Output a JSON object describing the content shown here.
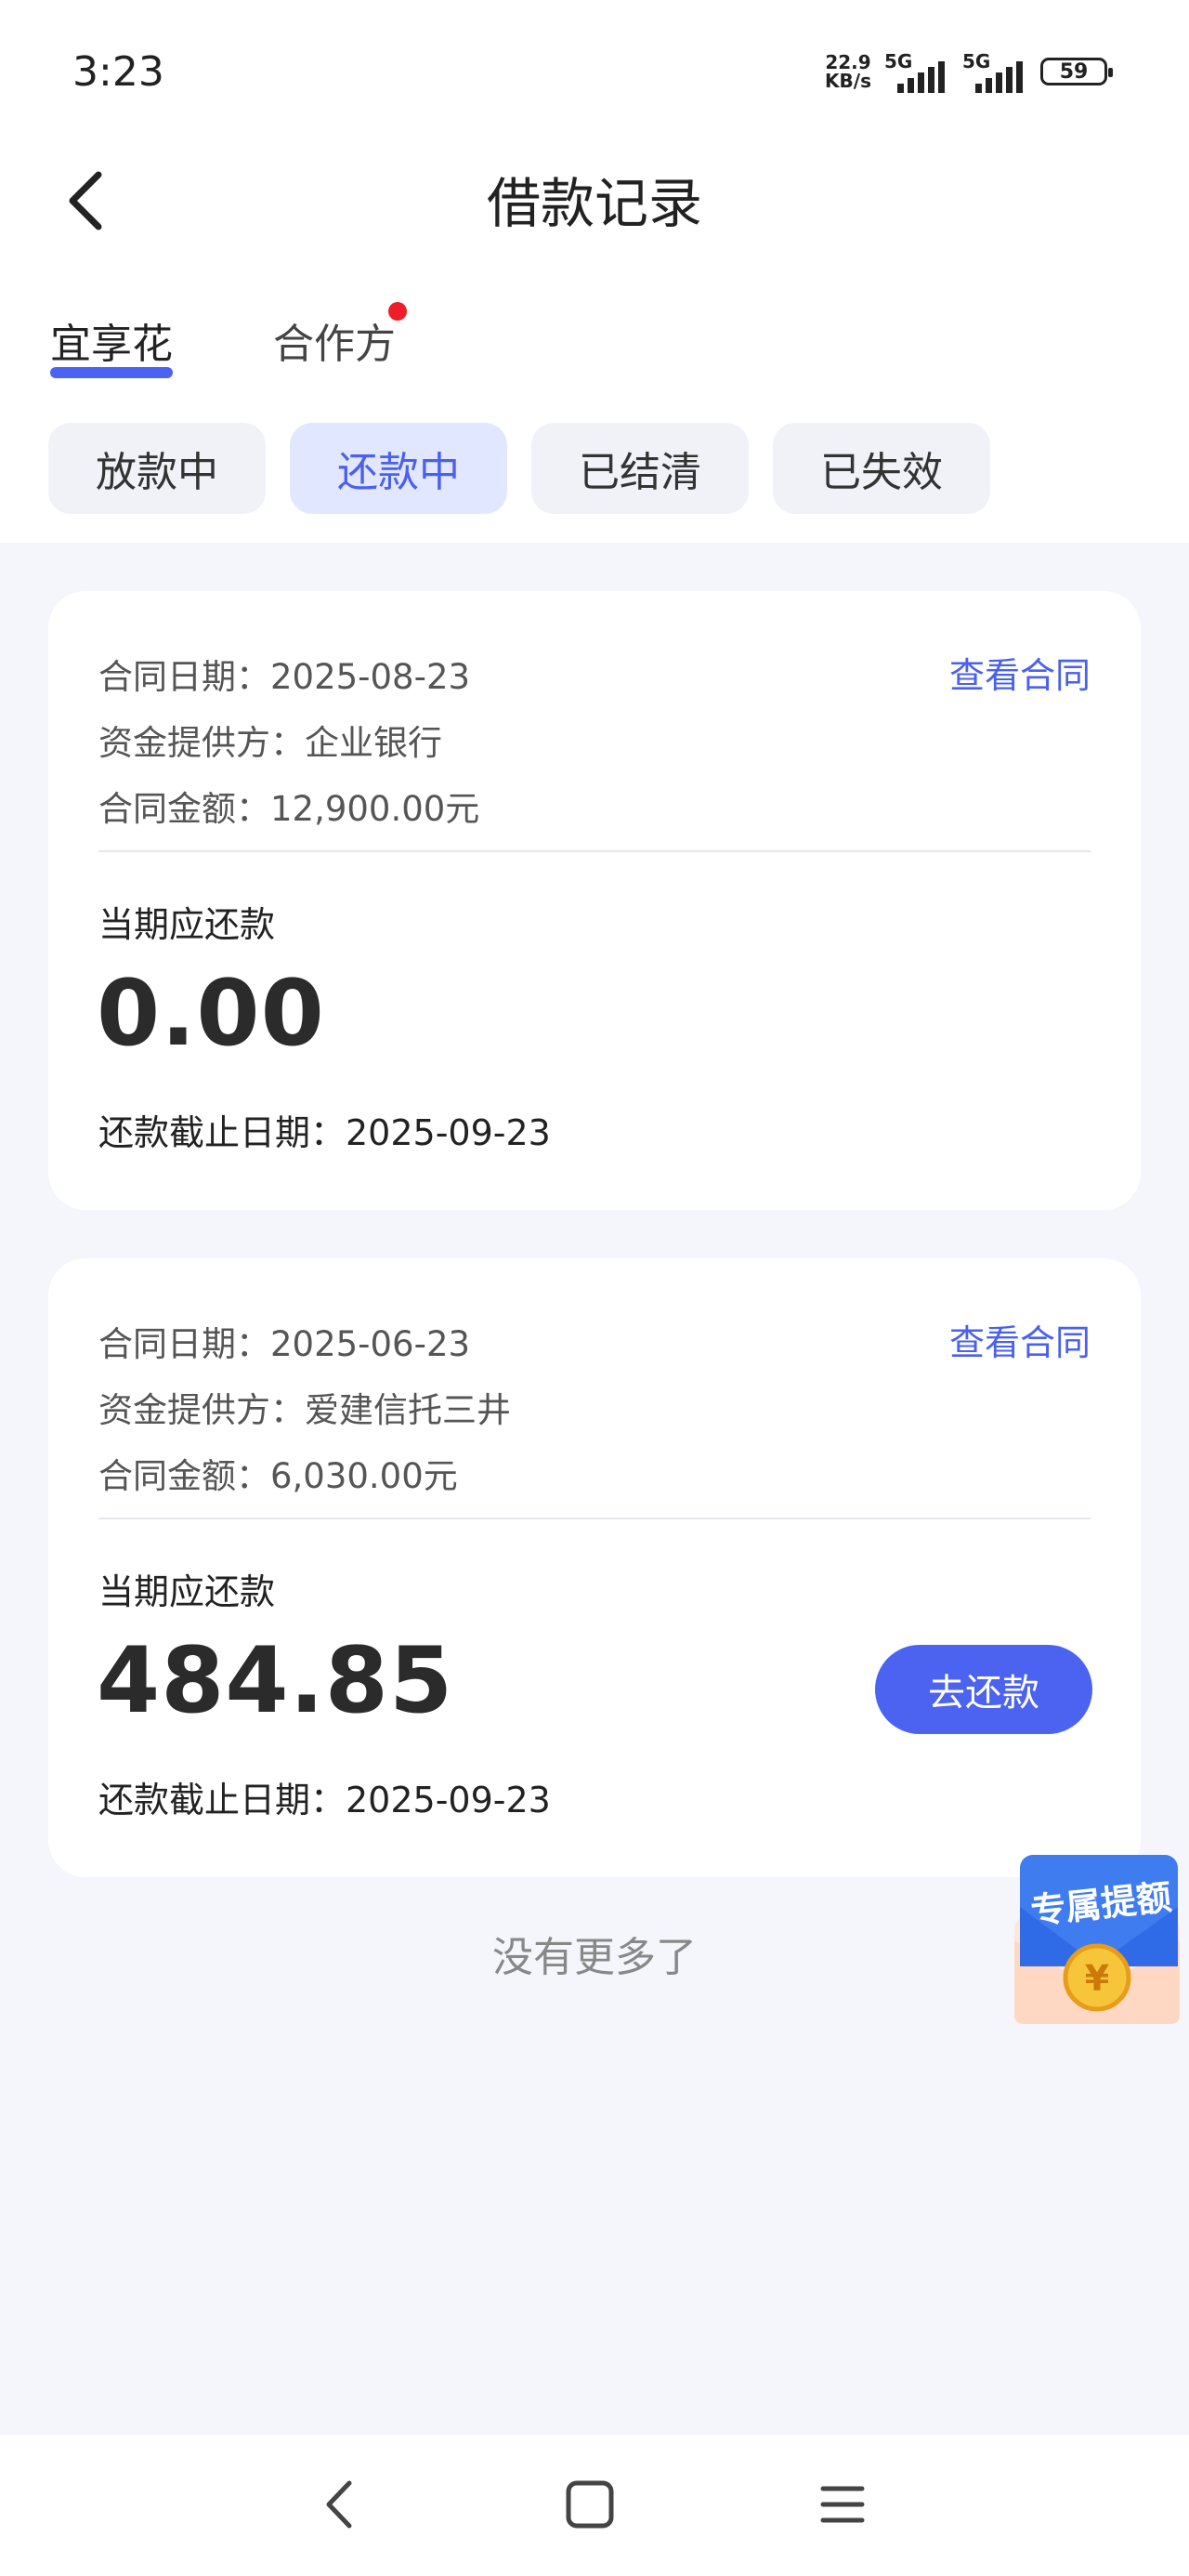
{
  "status_bar": {
    "time": "3:23",
    "net_speed_value": "22.9",
    "net_speed_unit": "KB/s",
    "sim1": "5G",
    "sim2": "5G",
    "battery": "59"
  },
  "header": {
    "title": "借款记录",
    "back_icon": "chevron-left-icon"
  },
  "tabs": [
    {
      "label": "宜享花",
      "active": true
    },
    {
      "label": "合作方",
      "active": false,
      "has_badge": true
    }
  ],
  "filters": [
    {
      "label": "放款中",
      "selected": false
    },
    {
      "label": "还款中",
      "selected": true
    },
    {
      "label": "已结清",
      "selected": false
    },
    {
      "label": "已失效",
      "selected": false
    }
  ],
  "loans": [
    {
      "contract_date": "合同日期：2025-08-23",
      "provider": "资金提供方：企业银行",
      "contract_amount": "合同金额：12,900.00元",
      "view_contract": "查看合同",
      "due_label": "当期应还款",
      "due_amount": "0.00",
      "deadline": "还款截止日期：2025-09-23"
    },
    {
      "contract_date": "合同日期：2025-06-23",
      "provider": "资金提供方：爱建信托三井",
      "contract_amount": "合同金额：6,030.00元",
      "view_contract": "查看合同",
      "due_label": "当期应还款",
      "due_amount": "484.85",
      "deadline": "还款截止日期：2025-09-23",
      "action": "去还款"
    }
  ],
  "footer_text": "没有更多了",
  "promo": {
    "label": "专属提额",
    "coin_symbol": "¥"
  },
  "colors": {
    "accent": "#4b63f0",
    "badge": "#ef1c2a",
    "background": "#f4f6fb"
  },
  "nav": {
    "back_icon": "back-triangle-icon",
    "home_icon": "home-square-icon",
    "menu_icon": "menu-icon"
  }
}
